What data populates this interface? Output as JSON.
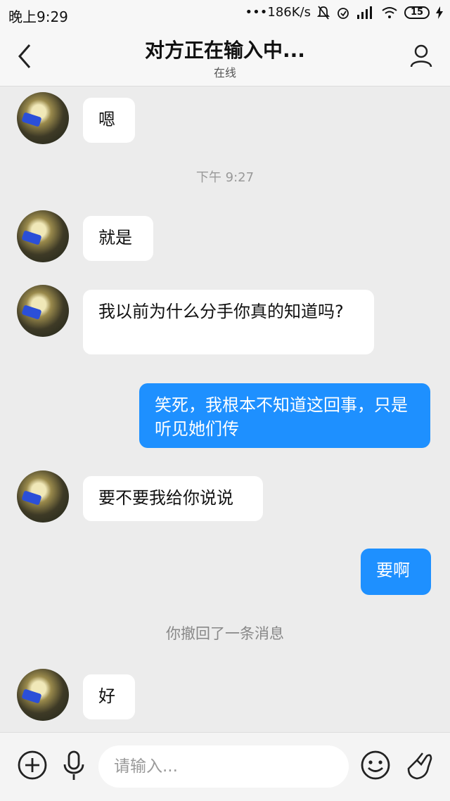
{
  "status_bar": {
    "time": "晚上9:29",
    "network_speed": "•••186K/s",
    "battery": "15"
  },
  "header": {
    "title": "对方正在输入中...",
    "subtitle": "在线"
  },
  "messages": [
    {
      "side": "other",
      "text": "嗯"
    },
    {
      "type": "timestamp",
      "text": "下午 9:27"
    },
    {
      "side": "other",
      "text": "就是"
    },
    {
      "side": "other",
      "text": "我以前为什么分手你真的知道吗?"
    },
    {
      "side": "self",
      "text": "笑死，我根本不知道这回事，只是听见她们传"
    },
    {
      "side": "other",
      "text": "要不要我给你说说"
    },
    {
      "side": "self",
      "text": "要啊"
    },
    {
      "type": "notice",
      "text": "你撤回了一条消息"
    },
    {
      "side": "other",
      "text": "好"
    }
  ],
  "input_bar": {
    "placeholder": "请输入..."
  },
  "icons": {
    "back": "chevron-left-icon",
    "profile": "person-icon",
    "add": "plus-circle-icon",
    "voice": "microphone-icon",
    "emoji": "smiley-icon",
    "gesture": "hand-icon"
  },
  "colors": {
    "self_bubble": "#1e90ff",
    "other_bubble": "#ffffff",
    "chat_background": "#ececec"
  }
}
